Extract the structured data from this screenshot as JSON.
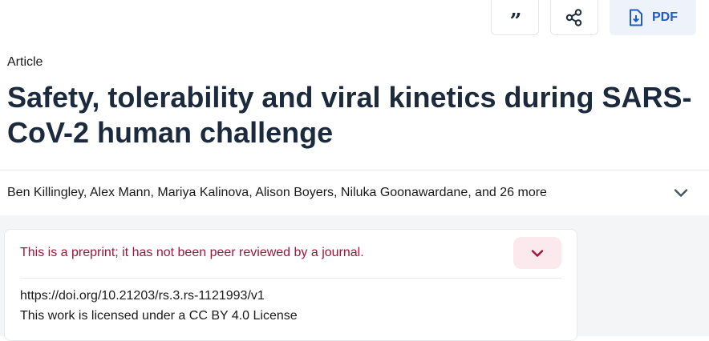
{
  "toolbar": {
    "cite_glyph": "”",
    "pdf_label": "PDF"
  },
  "article": {
    "type": "Article",
    "title": "Safety, tolerability and viral kinetics during SARS-CoV-2 human challenge",
    "authors": "Ben Killingley, Alex Mann, Mariya Kalinova, Alison Boyers, Niluka Goonawardane, and 26 more"
  },
  "preprint_card": {
    "notice": "This is a preprint; it has not been peer reviewed by a journal.",
    "doi": "https://doi.org/10.21203/rs.3.rs-1121993/v1",
    "license": "This work is licensed under a CC BY 4.0 License"
  },
  "colors": {
    "title": "#1b2a3d",
    "accent_blue": "#1f5cc4",
    "pdf_bg": "#eef3fb",
    "notice_red": "#a3143b",
    "notice_toggle_bg": "#fbe9ed"
  },
  "icons": {
    "cite": "quote-icon",
    "share": "share-icon",
    "pdf": "pdf-download-icon",
    "authors_expand": "chevron-down-icon",
    "notice_expand": "chevron-down-icon"
  }
}
